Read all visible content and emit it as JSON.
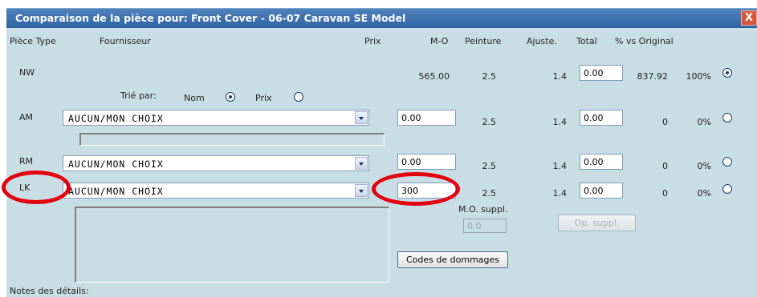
{
  "window": {
    "title": "Comparaison de la pièce pour: Front Cover - 06-07 Caravan SE Model",
    "close_glyph": "X"
  },
  "headers": {
    "piece_type": "Pièce Type",
    "fournisseur": "Fournisseur",
    "prix": "Prix",
    "mo": "M-O",
    "peinture": "Peinture",
    "ajuste": "Ajuste.",
    "total": "Total",
    "vs_original": "% vs Original"
  },
  "sort": {
    "label": "Trié par:",
    "nom": "Nom",
    "prix": "Prix",
    "selected": "Nom"
  },
  "rows": [
    {
      "type": "NW",
      "supplier": "",
      "prix": "",
      "mo": "565.00",
      "peinture": "2.5",
      "ajuste": "1.4",
      "total": "0.00",
      "amount": "837.92",
      "pct": "100%",
      "selected": true
    },
    {
      "type": "AM",
      "supplier": "AUCUN/MON CHOIX",
      "prix": "0.00",
      "mo": "",
      "peinture": "2.5",
      "ajuste": "1.4",
      "total": "0.00",
      "amount": "0",
      "pct": "0%",
      "selected": false
    },
    {
      "type": "RM",
      "supplier": "AUCUN/MON CHOIX",
      "prix": "0.00",
      "mo": "",
      "peinture": "2.5",
      "ajuste": "1.4",
      "total": "0.00",
      "amount": "0",
      "pct": "0%",
      "selected": false
    },
    {
      "type": "LK",
      "supplier": "AUCUN/MON CHOIX",
      "prix": "300",
      "mo": "",
      "peinture": "2.5",
      "ajuste": "1.4",
      "total": "0.00",
      "amount": "0",
      "pct": "0%",
      "selected": false
    }
  ],
  "mo_suppl": {
    "label": "M.O. suppl.",
    "value": "0.0"
  },
  "buttons": {
    "op_suppl": "Op. suppl.",
    "codes_dommages": "Codes de dommages"
  },
  "notes": {
    "label": "Notes des détails:"
  },
  "colors": {
    "titlebar": "#3a6eaa",
    "panel": "#c9dde5",
    "highlight_ring": "#e3000f"
  }
}
